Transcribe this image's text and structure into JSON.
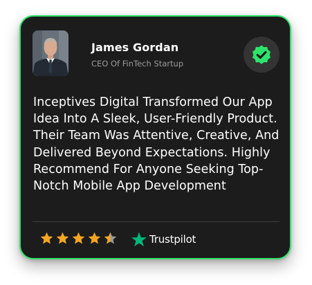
{
  "testimonial": {
    "author_name": "James Gordan",
    "author_role": "CEO Of FinTech Startup",
    "review_text": "Inceptives Digital Transformed Our App Idea Into A Sleek, User-Friendly Product. Their Team Was Attentive, Creative, And Delivered Beyond Expectations. Highly Recommend For Anyone Seeking Top-Notch Mobile App Development",
    "rating": 4.5,
    "rating_max": 5,
    "platform_name": "Trustpilot"
  },
  "colors": {
    "card_background": "#1c1c1c",
    "card_border": "#2ee36b",
    "verified_badge": "#2ee36b",
    "star_fill": "#f5a623",
    "star_empty": "#9a9a9a",
    "trustpilot_star": "#00b67a"
  },
  "icons": {
    "verified": "verified-check-badge-icon",
    "star": "star-icon",
    "platform": "trustpilot-star-icon"
  }
}
